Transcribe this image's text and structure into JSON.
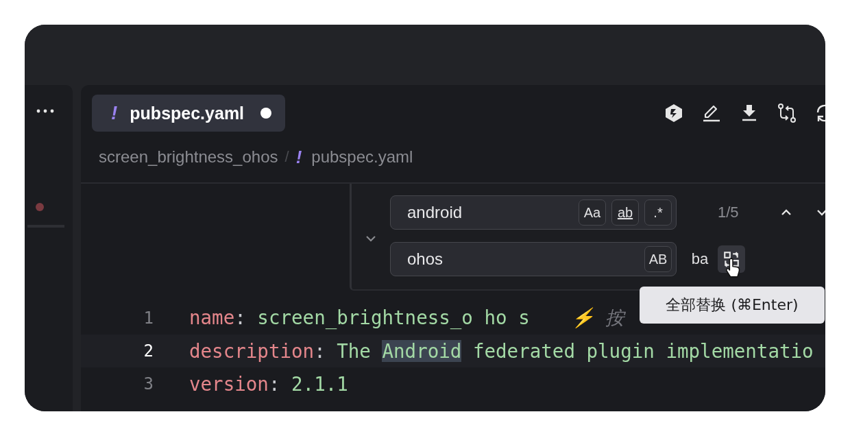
{
  "tab": {
    "icon": "!",
    "label": "pubspec.yaml",
    "selected": true,
    "modified": true
  },
  "breadcrumb": [
    {
      "kind": "folder",
      "text": "screen_brightness_ohos"
    },
    {
      "kind": "separator",
      "text": "/"
    },
    {
      "kind": "file",
      "icon": "!",
      "text": "pubspec.yaml"
    }
  ],
  "find_widget": {
    "expanded": true,
    "query": "android",
    "options": [
      {
        "kind": "case",
        "label": "Aa",
        "on": false
      },
      {
        "kind": "word",
        "label": "ab",
        "on": false
      },
      {
        "kind": "regex",
        "label": ".*",
        "on": false
      }
    ],
    "count": "1/5",
    "replace": "ohos",
    "replace_options": [
      {
        "label": "AB",
        "on": false
      }
    ],
    "replace_one": {
      "label": "ba",
      "hovered": false
    },
    "replace_all": {
      "hovered": true
    }
  },
  "tooltip": "全部替换 (⌘Enter)",
  "code_lines": [
    {
      "number": "1",
      "current": false,
      "tokens": [
        {
          "kind": "key",
          "text": "name"
        },
        {
          "kind": "punct",
          "text": ":"
        },
        {
          "kind": "value",
          "text": " screen_brightness_o ho s"
        },
        {
          "kind": "hint",
          "text": "⚡ 按"
        }
      ]
    },
    {
      "number": "2",
      "current": true,
      "tokens": [
        {
          "kind": "key",
          "text": "description"
        },
        {
          "kind": "punct",
          "text": ":"
        },
        {
          "kind": "value",
          "text": " The "
        },
        {
          "kind": "match",
          "text": "Android"
        },
        {
          "kind": "value",
          "text": " federated plugin implementatio"
        }
      ]
    },
    {
      "number": "3",
      "current": false,
      "tokens": [
        {
          "kind": "key",
          "text": "version"
        },
        {
          "kind": "punct",
          "text": ":"
        },
        {
          "kind": "value",
          "text": " 2.1.1"
        }
      ]
    }
  ]
}
